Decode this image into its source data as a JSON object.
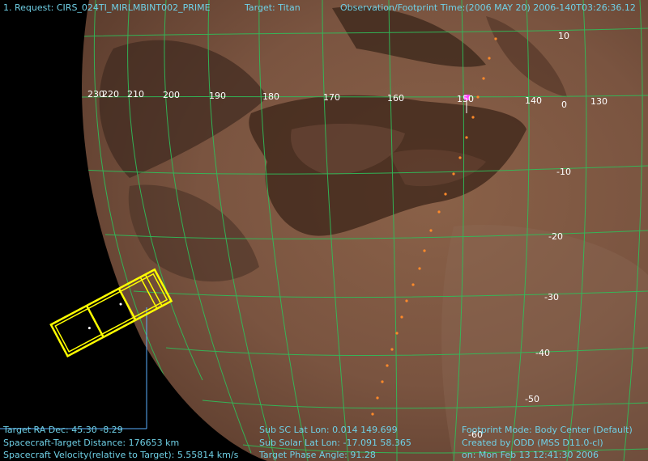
{
  "header": {
    "request": "1. Request: CIRS_024TI_MIRLMBINT002_PRIME",
    "target": "Target: Titan",
    "obs_time": "Observation/Footprint Time:(2006 MAY 20) 2006-140T03:26:36.12"
  },
  "lon_labels": [
    "230",
    "220",
    "210",
    "200",
    "190",
    "180",
    "170",
    "160",
    "150",
    "140",
    "0",
    "130"
  ],
  "lat_labels": [
    "10",
    "-10",
    "-20",
    "-30",
    "-40",
    "-50",
    "-60"
  ],
  "footer": {
    "left": [
      "Target RA Dec: 45.30  -8.29",
      "Spacecraft-Target Distance:  176653 km",
      "Spacecraft Velocity(relative to Target): 5.55814 km/s"
    ],
    "middle": [
      "Sub SC Lat Lon:  0.014  149.699",
      "Sub Solar Lat Lon:  -17.091  58.365",
      "Target Phase Angle: 91.28"
    ],
    "right": [
      "Footprint Mode: Body Center (Default)",
      "Created by ODD (MSS D11.0-cl)",
      "on: Mon Feb 13 12:41:30 2006"
    ]
  },
  "colors": {
    "hud_text": "#6fd0e6",
    "grid": "#2fbf5a",
    "footprint": "#ffff00",
    "track_dots": "#ff8a2a",
    "marker": "#ff44ff"
  }
}
